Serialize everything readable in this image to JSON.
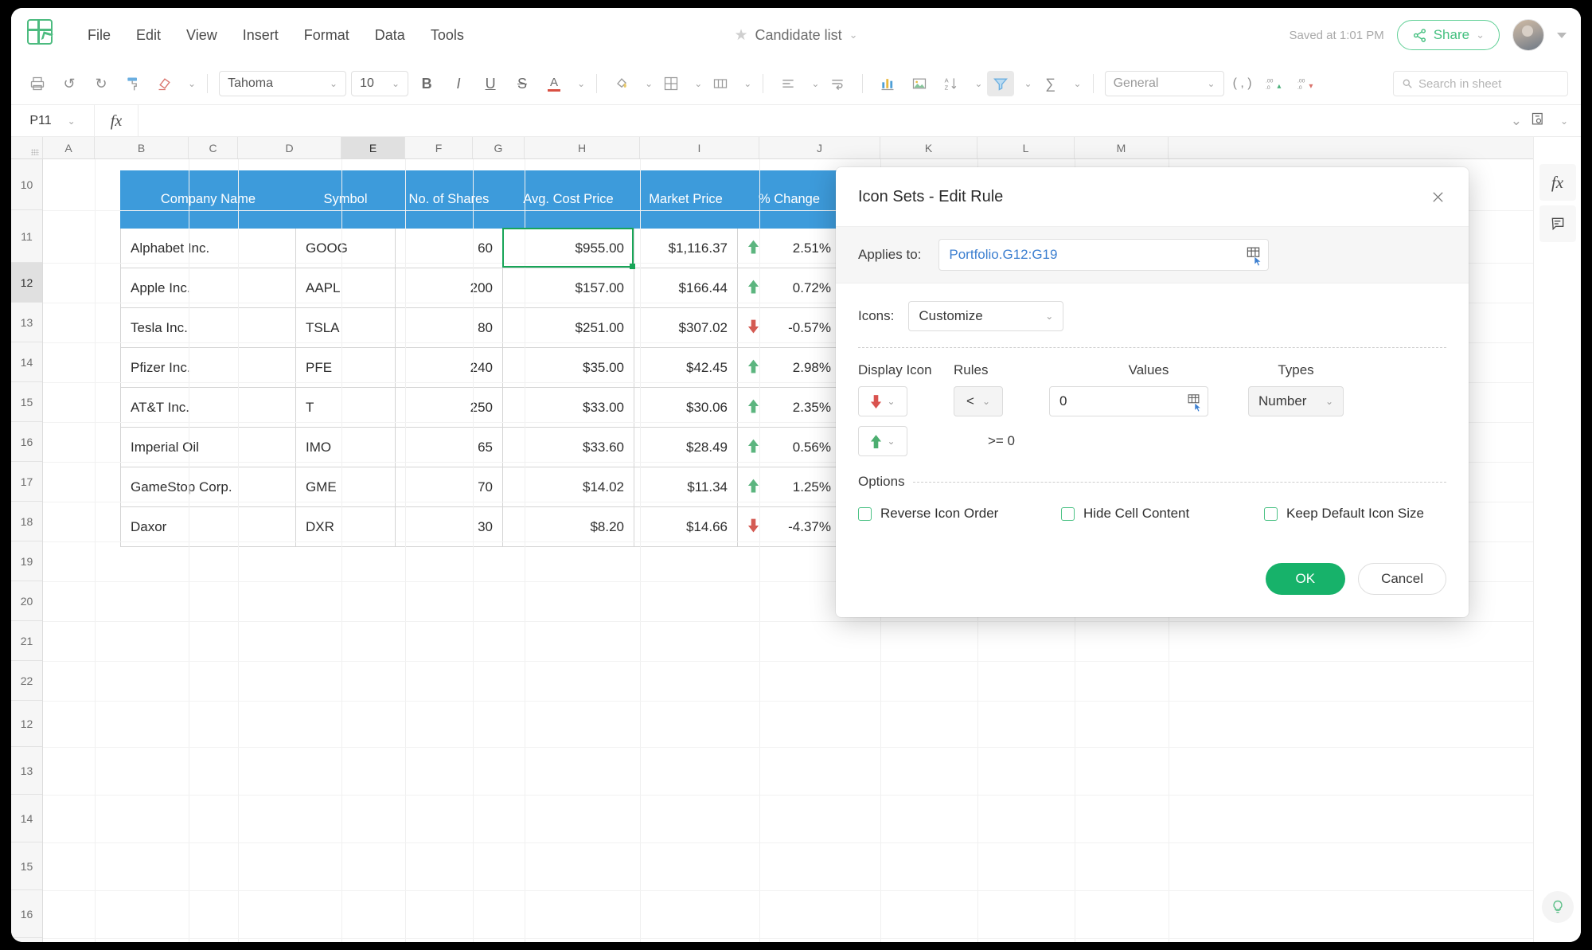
{
  "header": {
    "menu": [
      "File",
      "Edit",
      "View",
      "Insert",
      "Format",
      "Data",
      "Tools"
    ],
    "doc_title": "Candidate list",
    "saved_status": "Saved at 1:01 PM",
    "share_label": "Share"
  },
  "toolbar": {
    "font_name": "Tahoma",
    "font_size": "10",
    "number_format": "General",
    "bold": "B",
    "italic": "I",
    "underline": "U",
    "strikethrough": "S",
    "text_color": "A",
    "search_placeholder": "Search in sheet"
  },
  "formula_bar": {
    "name_box": "P11",
    "fx_label": "fx",
    "formula_value": ""
  },
  "grid": {
    "columns": [
      "A",
      "B",
      "C",
      "D",
      "E",
      "F",
      "G",
      "H",
      "I",
      "J",
      "K",
      "L",
      "M"
    ],
    "selected_column": "E",
    "rows": [
      "10",
      "11",
      "12",
      "13",
      "14",
      "15",
      "16",
      "17",
      "18",
      "19",
      "20",
      "21",
      "22",
      "12",
      "13",
      "14",
      "15",
      "16"
    ],
    "selected_row": "12",
    "selected_cell": "E12"
  },
  "table": {
    "headers": [
      "Company Name",
      "Symbol",
      "No. of Shares",
      "Avg. Cost Price",
      "Market Price",
      "% Change"
    ],
    "rows": [
      {
        "company": "Alphabet Inc.",
        "symbol": "GOOG",
        "shares": "60",
        "avg_cost": "$955.00",
        "market": "$1,116.37",
        "icon": "up",
        "change": "2.51%"
      },
      {
        "company": "Apple Inc.",
        "symbol": "AAPL",
        "shares": "200",
        "avg_cost": "$157.00",
        "market": "$166.44",
        "icon": "up",
        "change": "0.72%"
      },
      {
        "company": "Tesla Inc.",
        "symbol": "TSLA",
        "shares": "80",
        "avg_cost": "$251.00",
        "market": "$307.02",
        "icon": "down",
        "change": "-0.57%"
      },
      {
        "company": "Pfizer Inc.",
        "symbol": "PFE",
        "shares": "240",
        "avg_cost": "$35.00",
        "market": "$42.45",
        "icon": "up",
        "change": "2.98%"
      },
      {
        "company": "AT&T Inc.",
        "symbol": "T",
        "shares": "250",
        "avg_cost": "$33.00",
        "market": "$30.06",
        "icon": "up",
        "change": "2.35%"
      },
      {
        "company": "Imperial Oil",
        "symbol": "IMO",
        "shares": "65",
        "avg_cost": "$33.60",
        "market": "$28.49",
        "icon": "up",
        "change": "0.56%"
      },
      {
        "company": "GameStop Corp.",
        "symbol": "GME",
        "shares": "70",
        "avg_cost": "$14.02",
        "market": "$11.34",
        "icon": "up",
        "change": "1.25%"
      },
      {
        "company": "Daxor",
        "symbol": "DXR",
        "shares": "30",
        "avg_cost": "$8.20",
        "market": "$14.66",
        "icon": "down",
        "change": "-4.37%"
      }
    ]
  },
  "dialog": {
    "title": "Icon Sets - Edit Rule",
    "applies_to_label": "Applies to:",
    "applies_to_value": "Portfolio.G12:G19",
    "icons_label": "Icons:",
    "icons_value": "Customize",
    "column_headers": {
      "display_icon": "Display Icon",
      "rules": "Rules",
      "values": "Values",
      "types": "Types"
    },
    "rules": [
      {
        "icon": "down",
        "operator": "<",
        "value": "0",
        "type": "Number"
      },
      {
        "icon": "up",
        "static_condition": ">= 0"
      }
    ],
    "options_label": "Options",
    "options": [
      {
        "label": "Reverse Icon Order",
        "checked": false
      },
      {
        "label": "Hide Cell Content",
        "checked": false
      },
      {
        "label": "Keep Default Icon Size",
        "checked": false
      }
    ],
    "ok_label": "OK",
    "cancel_label": "Cancel"
  },
  "colors": {
    "table_header_blue": "#3d9bdb",
    "accent_green": "#17b26a",
    "selection_green": "#18a558",
    "up_arrow": "#5cb57f",
    "down_arrow": "#d45a52",
    "range_link_blue": "#3c7fd0"
  }
}
